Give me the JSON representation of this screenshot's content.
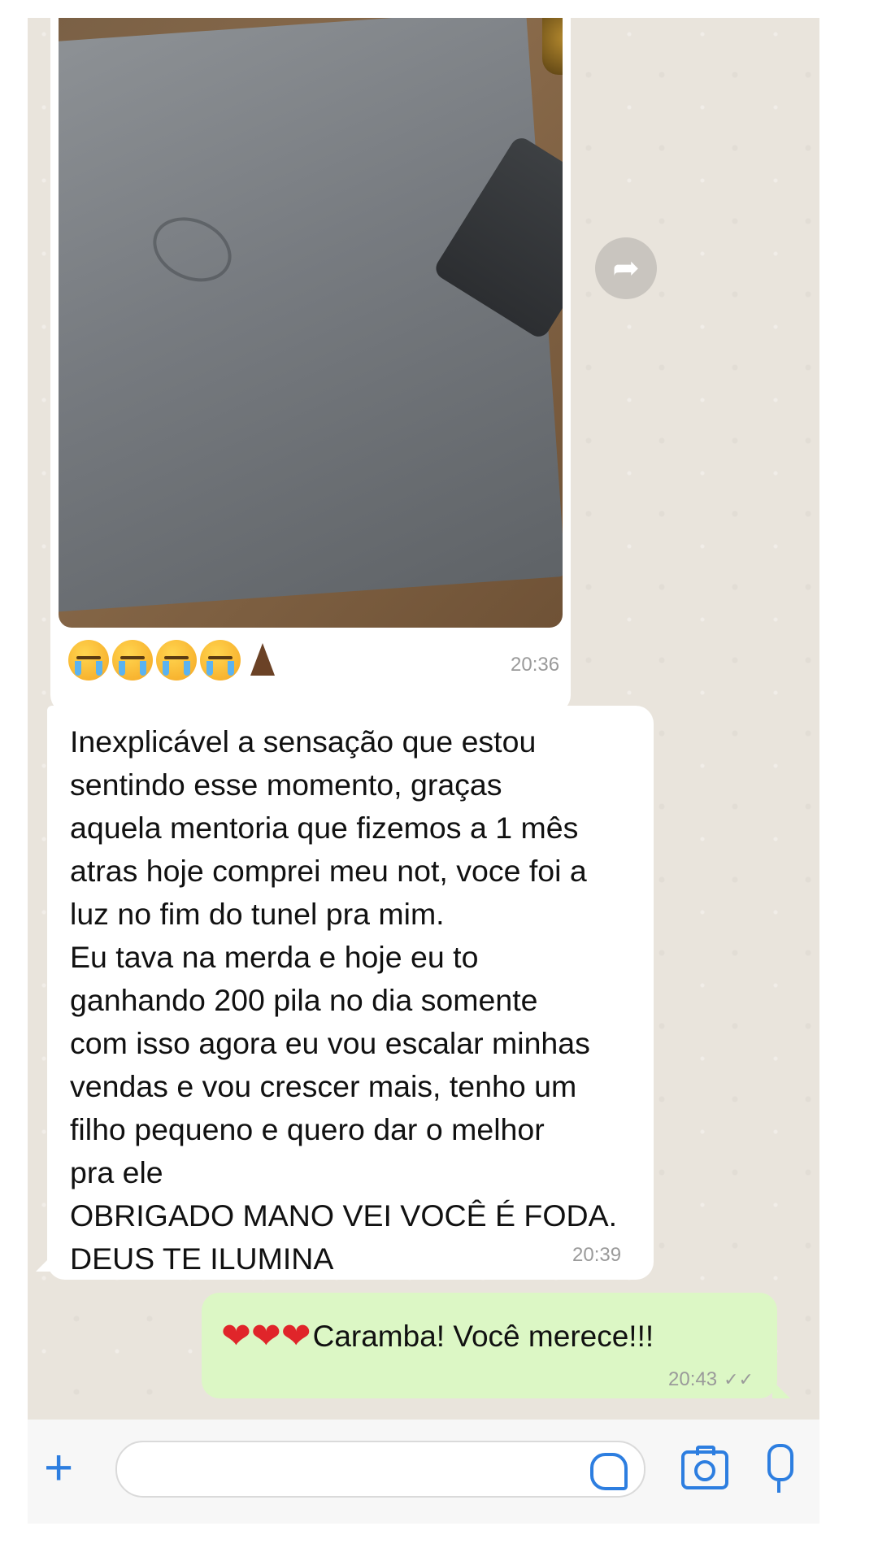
{
  "messages": [
    {
      "type": "image",
      "direction": "incoming",
      "caption_emojis": "😭😭😭😭🙏🏿",
      "time": "20:36"
    },
    {
      "type": "text",
      "direction": "incoming",
      "text": "Inexplicável a sensação que estou\nsentindo esse momento, graças\naquela mentoria que fizemos a 1 mês\natras hoje comprei meu not, voce foi a\nluz no fim do tunel pra mim.\nEu tava na merda e hoje eu to\nganhando 200 pila no dia somente\ncom isso agora eu vou escalar minhas\nvendas e vou crescer mais, tenho um\nfilho pequeno e quero dar o melhor\npra ele\nOBRIGADO MANO VEI VOCÊ É FODA.\nDEUS TE ILUMINA",
      "time": "20:39"
    },
    {
      "type": "text",
      "direction": "outgoing",
      "emoji_prefix": "❤❤❤",
      "text": "Caramba! Você merece!!!",
      "time": "20:43",
      "status": "read"
    }
  ],
  "input_bar": {
    "placeholder": "",
    "icons": [
      "plus-icon",
      "sticker-icon",
      "camera-icon",
      "mic-icon"
    ]
  },
  "colors": {
    "chat_bg": "#e9e4dc",
    "incoming_bubble": "#ffffff",
    "outgoing_bubble": "#dcf7c5",
    "accent": "#2d7ee0"
  }
}
